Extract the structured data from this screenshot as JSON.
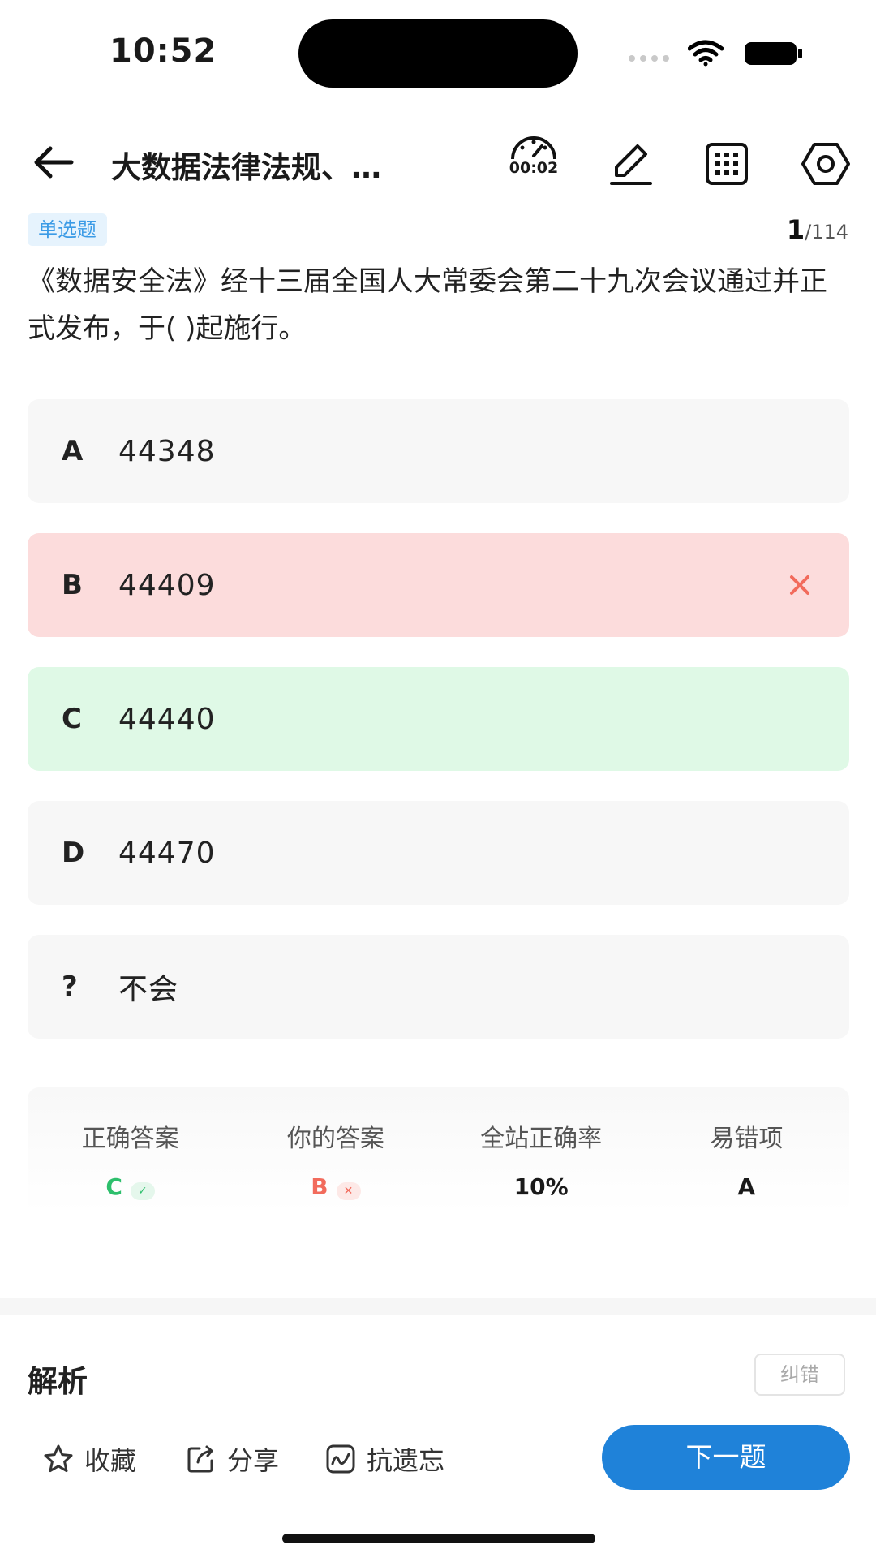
{
  "status_bar": {
    "time": "10:52"
  },
  "nav": {
    "title": "大数据法律法规、…",
    "timer": "00:02"
  },
  "question": {
    "type_badge": "单选题",
    "current": "1",
    "total": "/114",
    "text": "《数据安全法》经十三届全国人大常委会第二十九次会议通过并正式发布，于( )起施行。"
  },
  "options": [
    {
      "letter": "A",
      "text": "44348",
      "state": "neutral"
    },
    {
      "letter": "B",
      "text": "44409",
      "state": "wrong"
    },
    {
      "letter": "C",
      "text": "44440",
      "state": "correct"
    },
    {
      "letter": "D",
      "text": "44470",
      "state": "neutral"
    },
    {
      "letter": "?",
      "text": "不会",
      "state": "neutral"
    }
  ],
  "stats": {
    "correct_label": "正确答案",
    "correct_value": "C",
    "yours_label": "你的答案",
    "yours_value": "B",
    "rate_label": "全站正确率",
    "rate_value": "10%",
    "error_label": "易错项",
    "error_value": "A"
  },
  "analysis": {
    "title": "解析",
    "report_label": "纠错"
  },
  "bottom": {
    "favorite": "收藏",
    "share": "分享",
    "memory": "抗遗忘",
    "next": "下一题"
  },
  "colors": {
    "accent": "#1f82d9",
    "correct": "#2dbf6c",
    "wrong": "#f26b5c",
    "wrong_bg": "#fcdcdc",
    "correct_bg": "#dff9e6"
  },
  "icons": [
    "wifi-icon",
    "battery-icon",
    "back-arrow-icon",
    "speedometer-icon",
    "pencil-icon",
    "grid-icon",
    "hexagon-settings-icon",
    "close-icon",
    "check-icon",
    "star-icon",
    "share-icon",
    "chart-icon"
  ]
}
